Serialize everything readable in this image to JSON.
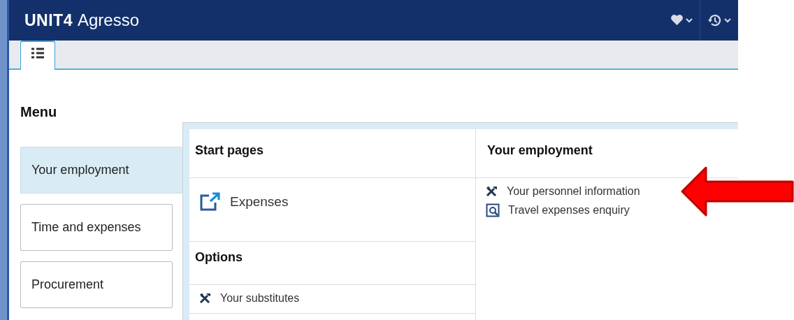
{
  "header": {
    "brand": "UNIT4",
    "product": "Agresso"
  },
  "tabs": [
    {
      "kind": "menu",
      "selected": true
    }
  ],
  "menu": {
    "title": "Menu",
    "items": [
      {
        "label": "Your employment",
        "selected": true
      },
      {
        "label": "Time and expenses",
        "selected": false
      },
      {
        "label": "Procurement",
        "selected": false
      }
    ]
  },
  "panel": {
    "columns": [
      {
        "groups": [
          {
            "title": "Start pages",
            "items": [
              {
                "label": "Expenses",
                "kind": "start-page"
              }
            ]
          },
          {
            "title": "Options",
            "items": [
              {
                "label": "Your substitutes",
                "kind": "task"
              }
            ]
          }
        ]
      },
      {
        "groups": [
          {
            "title": "Your employment",
            "items": [
              {
                "label": "Your personnel information",
                "kind": "task"
              },
              {
                "label": "Travel expenses enquiry",
                "kind": "enquiry"
              }
            ]
          }
        ]
      }
    ]
  }
}
